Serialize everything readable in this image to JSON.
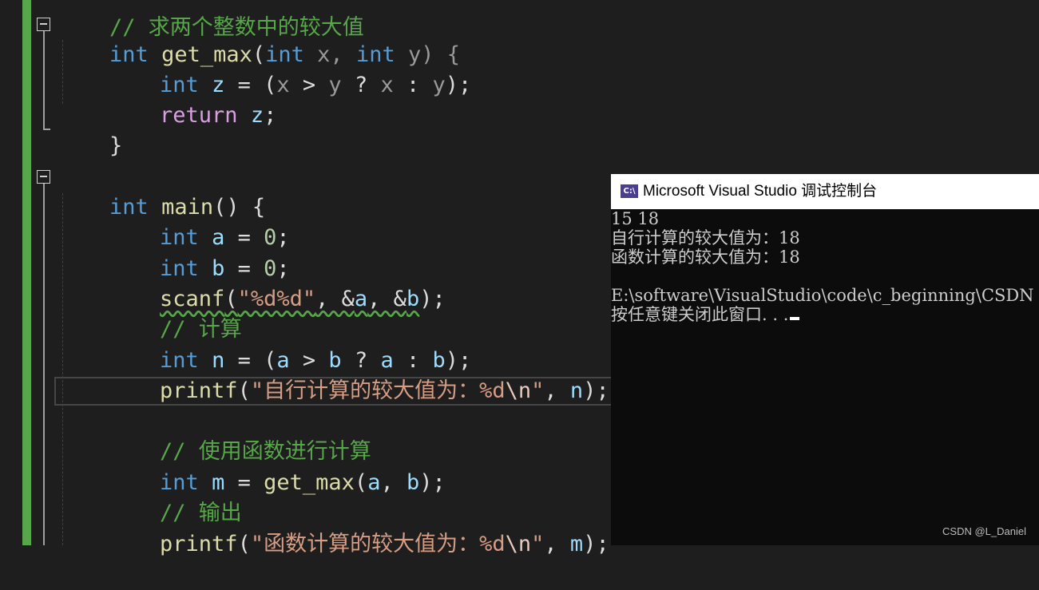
{
  "editor": {
    "top_partial_comment": "// 求两个整数中的较大值",
    "lines": {
      "l1": {
        "t1": "int",
        "t2": " ",
        "t3": "get_max",
        "t4": "(",
        "t5": "int",
        "t6": " x, ",
        "t7": "int",
        "t8": " y) {"
      },
      "l2": {
        "t1": "int",
        "t2": " ",
        "t3": "z",
        "t4": " = (",
        "t5": "x",
        "t6": " > ",
        "t7": "y",
        "t8": " ? ",
        "t9": "x",
        "t10": " : ",
        "t11": "y",
        "t12": ");"
      },
      "l3": {
        "t1": "return",
        "t2": " ",
        "t3": "z",
        "t4": ";"
      },
      "l4": {
        "t1": "}"
      },
      "l5": {
        "t1": "int",
        "t2": " ",
        "t3": "main",
        "t4": "() {"
      },
      "l6": {
        "t1": "int",
        "t2": " ",
        "t3": "a",
        "t4": " = ",
        "t5": "0",
        "t6": ";"
      },
      "l7": {
        "t1": "int",
        "t2": " ",
        "t3": "b",
        "t4": " = ",
        "t5": "0",
        "t6": ";"
      },
      "l8": {
        "t1": "scanf",
        "t2": "(",
        "t3": "\"%d%d\"",
        "t4": ", &",
        "t5": "a",
        "t6": ", &",
        "t7": "b",
        "t8": ");"
      },
      "l9": {
        "t1": "// 计算"
      },
      "l10": {
        "t1": "int",
        "t2": " ",
        "t3": "n",
        "t4": " = (",
        "t5": "a",
        "t6": " > ",
        "t7": "b",
        "t8": " ? ",
        "t9": "a",
        "t10": " : ",
        "t11": "b",
        "t12": ");"
      },
      "l11": {
        "t1": "printf",
        "t2": "(",
        "t3": "\"自行计算的较大值为：%d",
        "t4": "\\n",
        "t5": "\"",
        "t6": ", ",
        "t7": "n",
        "t8": ");"
      },
      "l12": {
        "t1": "// 使用函数进行计算"
      },
      "l13": {
        "t1": "int",
        "t2": " ",
        "t3": "m",
        "t4": " = ",
        "t5": "get_max",
        "t6": "(",
        "t7": "a",
        "t8": ", ",
        "t9": "b",
        "t10": ");"
      },
      "l14": {
        "t1": "// 输出"
      },
      "l15": {
        "t1": "printf",
        "t2": "(",
        "t3": "\"函数计算的较大值为：%d",
        "t4": "\\n",
        "t5": "\"",
        "t6": ", ",
        "t7": "m",
        "t8": ");"
      }
    }
  },
  "console": {
    "icon_text": "C:\\",
    "title": "Microsoft Visual Studio 调试控制台",
    "lines": [
      "15 18",
      "自行计算的较大值为：18",
      "函数计算的较大值为：18",
      "",
      "E:\\software\\VisualStudio\\code\\c_beginning\\CSDN",
      "按任意键关闭此窗口. . ."
    ]
  },
  "watermark": "CSDN @L_Daniel"
}
